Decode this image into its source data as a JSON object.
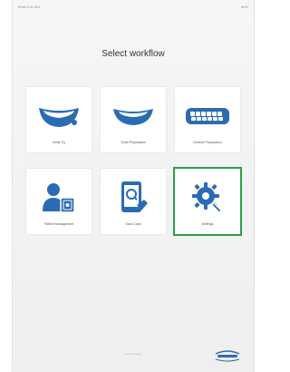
{
  "status_bar": {
    "left": "iPad 9:41 AM",
    "right": "84%"
  },
  "title": "Select workflow",
  "tiles": [
    {
      "label": "Smile Try",
      "icon": "smile-icon"
    },
    {
      "label": "Tooth Preparation",
      "icon": "teeth-icon"
    },
    {
      "label": "Denture Preparation",
      "icon": "denture-icon"
    },
    {
      "label": "Patient Management",
      "icon": "user-document-icon"
    },
    {
      "label": "Scan Case",
      "icon": "tablet-search-icon"
    },
    {
      "label": "Settings",
      "icon": "gear-wrench-icon"
    }
  ],
  "footer": {
    "text": "Ivoclar Digital"
  },
  "colors": {
    "accent": "#2a6cb3",
    "selected_outline": "#2e9e4a"
  }
}
